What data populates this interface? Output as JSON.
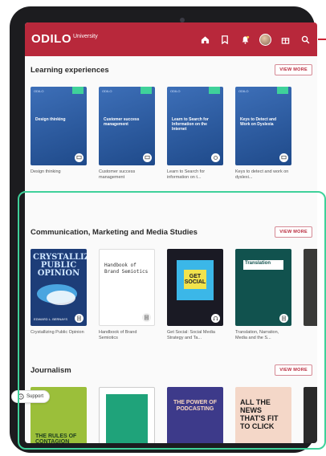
{
  "app": {
    "logo_main": "ODILO",
    "logo_sub": "University"
  },
  "nav": {
    "icons": [
      "home-icon",
      "bookmark-icon",
      "notification-bell-icon",
      "avatar",
      "gift-box-icon",
      "search-icon"
    ]
  },
  "sections": [
    {
      "title": "Learning experiences",
      "view_more": "VIEW MORE",
      "items": [
        {
          "cover_brand": "ODILO",
          "cover_title": "Design thinking",
          "caption": "Design thinking"
        },
        {
          "cover_brand": "ODILO",
          "cover_title": "Customer success management",
          "caption": "Customer success management"
        },
        {
          "cover_brand": "ODILO",
          "cover_title": "Learn to Search for Information on the Internet",
          "caption": "Learn to Search for information on t..."
        },
        {
          "cover_brand": "ODILO",
          "cover_title": "Keys to Detect and Work on Dyslexia",
          "caption": "Keys to detect and work on dyslexi..."
        }
      ]
    },
    {
      "title": "Communication, Marketing and Media Studies",
      "view_more": "VIEW MORE",
      "items": [
        {
          "cover_title": "CRYSTALLIZING PUBLIC OPINION",
          "cover_author": "EDWARD L. BERNAYS",
          "caption": "Crystallizing Public Opinion"
        },
        {
          "cover_title": "Handbook of Brand Semiotics",
          "caption": "Handbook of Brand Semiotics"
        },
        {
          "cover_title": "GET SOCIAL",
          "caption": "Get Social: Social Media Strategy and Ta..."
        },
        {
          "cover_title": "Translation",
          "caption": "Translation, Narration, Media and the S..."
        }
      ]
    },
    {
      "title": "Journalism",
      "view_more": "VIEW MORE",
      "items": [
        {
          "cover_title": "THE RULES OF CONTAGION"
        },
        {
          "cover_title": ""
        },
        {
          "cover_title": "THE POWER OF PODCASTING"
        },
        {
          "cover_title": "ALL THE NEWS THAT'S FIT TO CLICK"
        }
      ]
    }
  ],
  "support": {
    "label": "Support"
  },
  "colors": {
    "brand": "#b8283b",
    "highlight": "#3fd19a"
  }
}
